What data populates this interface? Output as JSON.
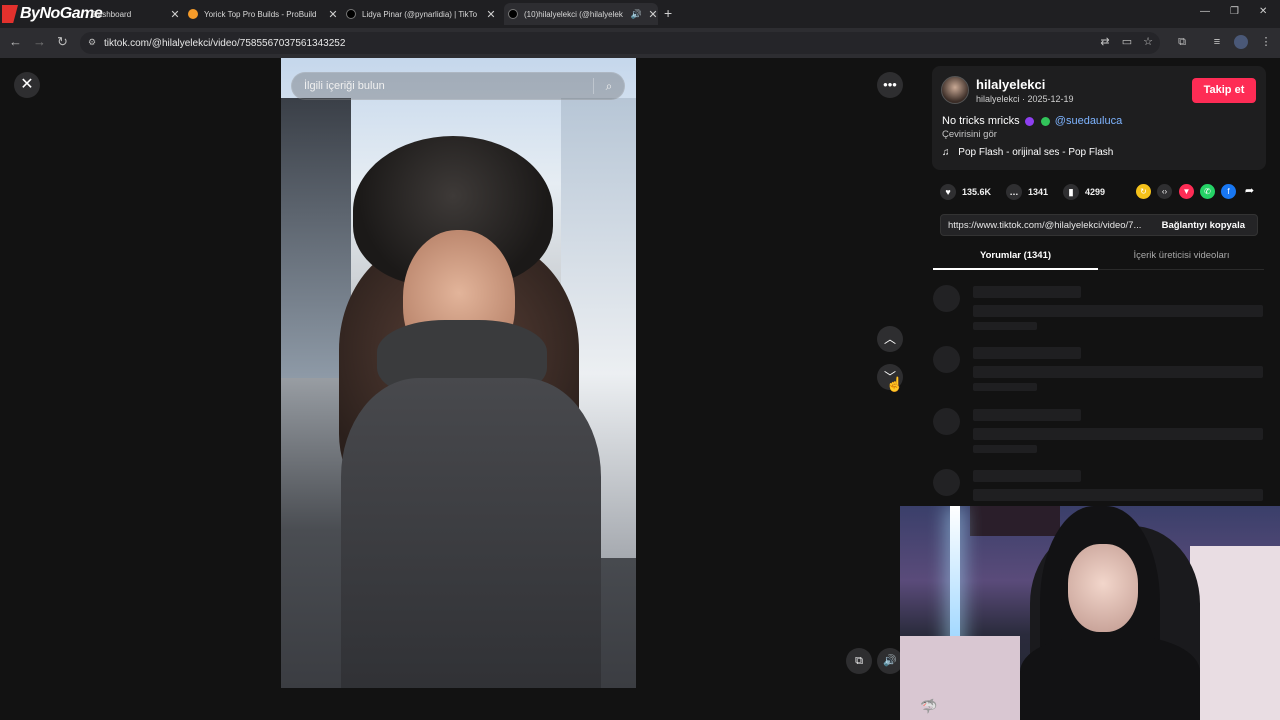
{
  "brand": {
    "logo_text": "ByNoGame"
  },
  "tabs": [
    {
      "label": "Dashboard"
    },
    {
      "label": "Yorick Top Pro Builds - ProBuild"
    },
    {
      "label": "Lidya Pinar (@pynarlidia) | TikTo"
    },
    {
      "label": "(10)hilalyelekci (@hilalyelek"
    }
  ],
  "address": {
    "url": "tiktok.com/@hilalyelekci/video/7585567037561343252"
  },
  "player": {
    "search_placeholder": "İlgili içeriği bulun"
  },
  "post": {
    "username": "hilalyelekci",
    "handle_date": "hilalyelekci · 2025-12-19",
    "follow_label": "Takip et",
    "description": "No tricks mricks",
    "mention": "@suedauluca",
    "translate_label": "Çevirisini gör",
    "music": "Pop Flash - orijinal ses - Pop Flash",
    "likes": "135.6K",
    "comments": "1341",
    "saves": "4299",
    "link_text": "https://www.tiktok.com/@hilalyelekci/video/7...",
    "copy_label": "Bağlantıyı kopyala"
  },
  "panel_tabs": [
    {
      "label": "Yorumlar (1341)"
    },
    {
      "label": "İçerik üreticisi videoları"
    }
  ],
  "colors": {
    "accent": "#fe2c55",
    "mention": "#7eb4ff",
    "bg": "#121212"
  }
}
